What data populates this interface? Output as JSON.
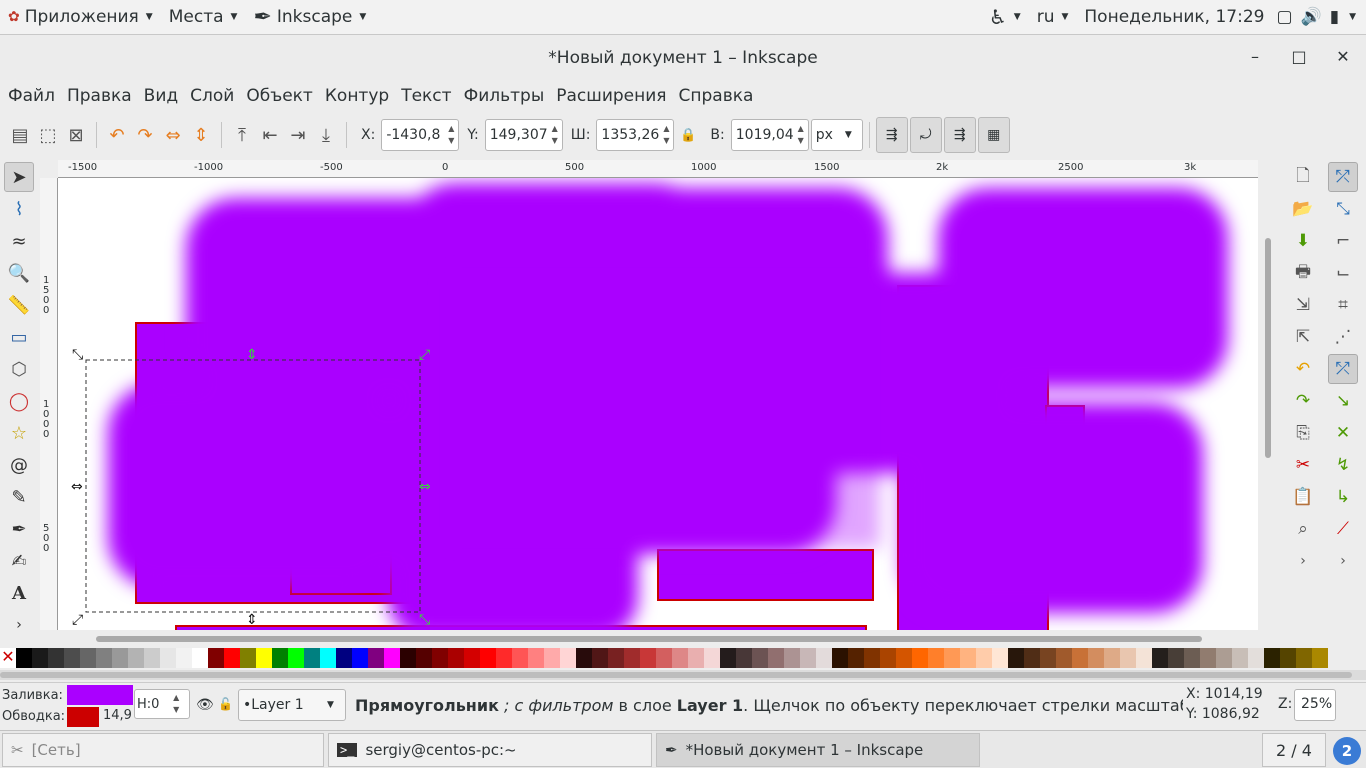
{
  "topbar": {
    "apps": "Приложения",
    "places": "Места",
    "active_app": "Inkscape",
    "lang": "ru",
    "clock": "Понедельник, 17:29"
  },
  "window": {
    "title": "*Новый документ 1 – Inkscape"
  },
  "menu": [
    "Файл",
    "Правка",
    "Вид",
    "Слой",
    "Объект",
    "Контур",
    "Текст",
    "Фильтры",
    "Расширения",
    "Справка"
  ],
  "toolbar": {
    "x_label": "X:",
    "x_value": "-1430,8",
    "y_label": "Y:",
    "y_value": "149,307",
    "w_label": "Ш:",
    "w_value": "1353,26",
    "h_label": "В:",
    "h_value": "1019,04",
    "unit": "px"
  },
  "ruler": {
    "h_ticks": [
      "-1500",
      "-1000",
      "-500",
      "0",
      "500",
      "1000",
      "1500",
      "2k",
      "2500",
      "3k"
    ],
    "v_ticks": [
      "1500",
      "1000",
      "500"
    ]
  },
  "palette_colors": [
    "#000000",
    "#1a1a1a",
    "#333333",
    "#4d4d4d",
    "#666666",
    "#808080",
    "#999999",
    "#b3b3b3",
    "#cccccc",
    "#e6e6e6",
    "#f2f2f2",
    "#ffffff",
    "#800000",
    "#ff0000",
    "#808000",
    "#ffff00",
    "#008000",
    "#00ff00",
    "#008080",
    "#00ffff",
    "#000080",
    "#0000ff",
    "#800080",
    "#ff00ff",
    "#2b0000",
    "#550000",
    "#800000",
    "#aa0000",
    "#d40000",
    "#ff0000",
    "#ff2a2a",
    "#ff5555",
    "#ff8080",
    "#ffaaaa",
    "#ffd5d5",
    "#280b0b",
    "#501616",
    "#782121",
    "#a02c2c",
    "#c83737",
    "#d35f5f",
    "#de8787",
    "#e9afaf",
    "#f4d7d7",
    "#241c1c",
    "#483737",
    "#6c5353",
    "#916f6f",
    "#ac9393",
    "#c8b7b7",
    "#e3dbdb",
    "#2b1100",
    "#552200",
    "#803300",
    "#aa4400",
    "#d45500",
    "#ff6600",
    "#ff7f2a",
    "#ff9955",
    "#ffb380",
    "#ffccaa",
    "#ffe6d5",
    "#28170b",
    "#502d16",
    "#784421",
    "#a05a2c",
    "#c87137",
    "#d38d5f",
    "#deaa87",
    "#e9c6af",
    "#f4e3d7",
    "#241f1c",
    "#483e37",
    "#6c5d53",
    "#917c6f",
    "#ac9d93",
    "#c8beb7",
    "#e3dedb",
    "#2b2200",
    "#554400",
    "#806600",
    "#aa8800"
  ],
  "status": {
    "fill_label": "Заливка:",
    "stroke_label": "Обводка:",
    "stroke_width": "14,9",
    "h_label": "H:",
    "h_value": "0",
    "layer": "•Layer 1",
    "msg_bold": "Прямоугольник",
    "msg_italic": " ; с фильтром",
    "msg_mid": " в слое ",
    "msg_layer": "Layer 1",
    "msg_rest": ". Щелчок по объекту переключает стрелки масштабир...",
    "cx": "X: 1014,19",
    "cy": "Y: 1086,92",
    "zoom_label": "Z:",
    "zoom": "25%",
    "fill_color": "#aa00ff",
    "stroke_color": "#cc0000"
  },
  "taskbar": {
    "network": "[Сеть]",
    "terminal": "sergiy@centos-pc:~",
    "inkscape": "*Новый документ 1 – Inkscape",
    "workspace": "2 / 4",
    "badge": "2"
  }
}
